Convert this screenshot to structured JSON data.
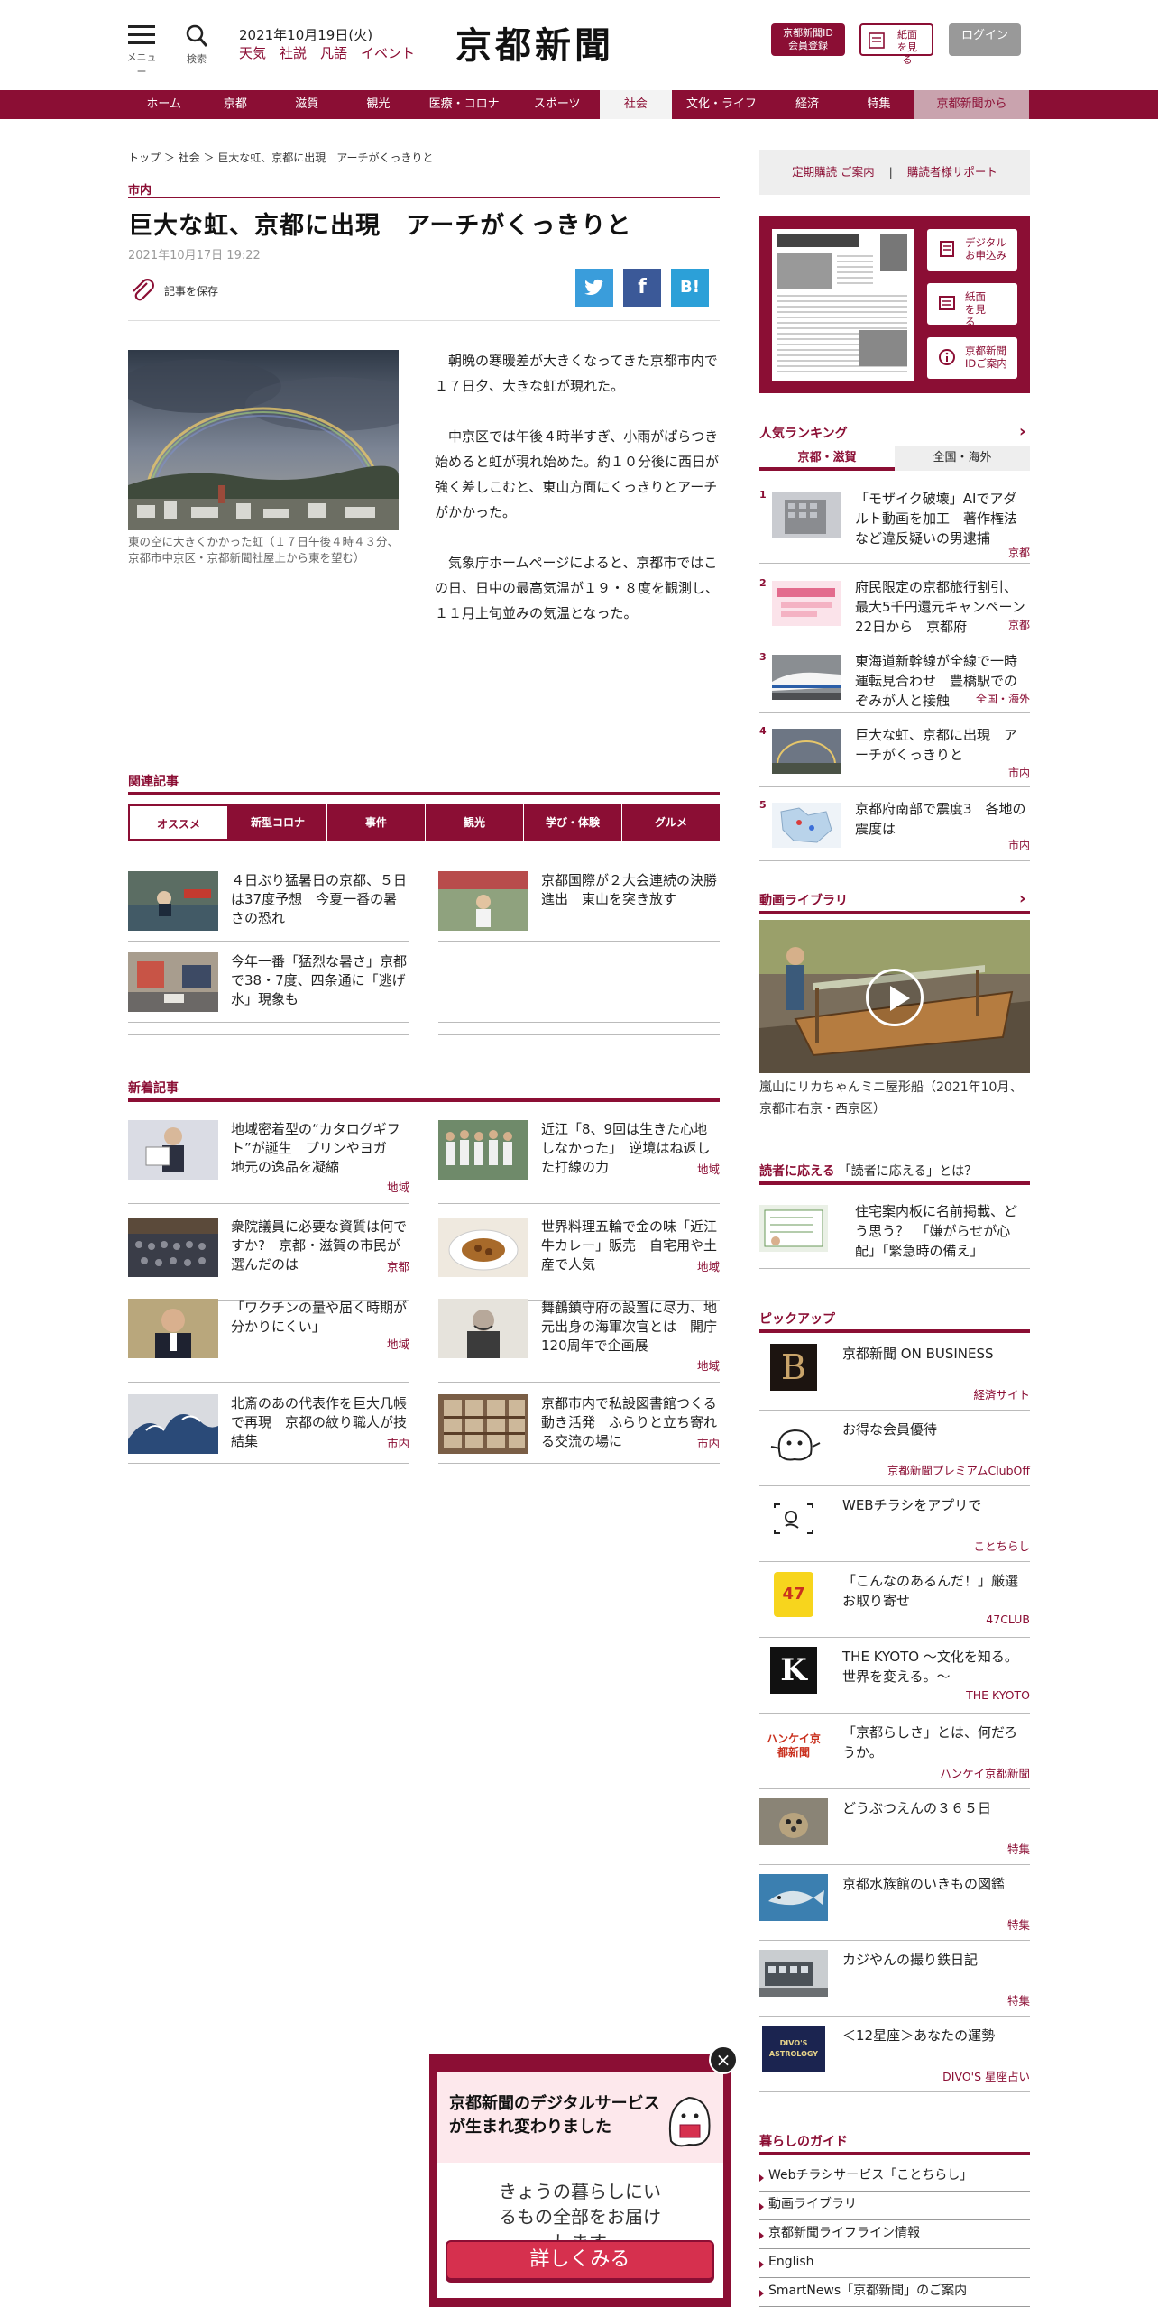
{
  "header": {
    "menu_label": "メニュー",
    "search_label": "検索",
    "date": "2021年10月19日(火)",
    "links": [
      "天気",
      "社説",
      "凡語",
      "イベント"
    ],
    "logo": "京都新聞",
    "id_button": "京都新聞ID会員登録",
    "paper_button": "紙面を見る",
    "login_button": "ログイン"
  },
  "nav": [
    "ホーム",
    "京都",
    "滋賀",
    "観光",
    "医療・コロナ",
    "スポーツ",
    "社会",
    "文化・ライフ",
    "経済",
    "特集",
    "京都新聞から"
  ],
  "breadcrumb": "トップ ＞ 社会 ＞ 巨大な虹、京都に出現　アーチがくっきりと",
  "article": {
    "section": "市内",
    "title": "巨大な虹、京都に出現　アーチがくっきりと",
    "date": "2021年10月17日 19:22",
    "save_label": "記事を保存",
    "photo_caption": "東の空に大きくかかった虹（１７日午後４時４３分、京都市中京区・京都新聞社屋上から東を望む）",
    "paragraphs": [
      "朝晩の寒暖差が大きくなってきた京都市内で１７日夕、大きな虹が現れた。",
      "中京区では午後４時半すぎ、小雨がぱらつき始めると虹が現れ始めた。約１０分後に西日が強く差しこむと、東山方面にくっきりとアーチがかかった。",
      "気象庁ホームページによると、京都市ではこの日、日中の最高気温が１９・８度を観測し、１１月上旬並みの気温となった。"
    ]
  },
  "related": {
    "heading": "関連記事",
    "tabs": [
      "オススメ",
      "新型コロナ",
      "事件",
      "観光",
      "学び・体験",
      "グルメ"
    ],
    "items": [
      {
        "title": "４日ぶり猛暑日の京都、５日は37度予想　今夏一番の暑さの恐れ"
      },
      {
        "title": "京都国際が２大会連続の決勝進出　東山を突き放す"
      },
      {
        "title": "今年一番「猛烈な暑さ」京都で38・7度、四条通に「逃げ水」現象も"
      }
    ]
  },
  "latest": {
    "heading": "新着記事",
    "items": [
      {
        "title": "地域密着型の“カタログギフト”が誕生　プリンやヨガ　地元の逸品を凝縮",
        "tag": "地域"
      },
      {
        "title": "近江「8、9回は生きた心地しなかった」　逆境はね返した打線の力",
        "tag": "地域"
      },
      {
        "title": "衆院議員に必要な資質は何ですか?　京都・滋賀の市民が選んだのは",
        "tag": "京都"
      },
      {
        "title": "世界料理五輪で金の味「近江牛カレー」販売　自宅用や土産で人気",
        "tag": "地域"
      },
      {
        "title": "「ワクチンの量や届く時期が分かりにくい」",
        "tag": "地域"
      },
      {
        "title": "舞鶴鎮守府の設置に尽力、地元出身の海軍次官とは　開庁120周年で企画展",
        "tag": "地域"
      },
      {
        "title": "北斎のあの代表作を巨大几帳で再現　京都の紋り職人が技結集",
        "tag": "市内"
      },
      {
        "title": "京都市内で私設図書館つくる動き活発　ふらりと立ち寄れる交流の場に",
        "tag": "市内"
      }
    ]
  },
  "sidebar": {
    "links": [
      "定期購読 ご案内",
      "|",
      "購読者様サポート"
    ],
    "paper_buttons": [
      "デジタルお申込み",
      "紙面を見る",
      "京都新聞IDご案内"
    ],
    "ranking": {
      "heading": "人気ランキング",
      "arrow": "›",
      "tabs": [
        "京都・滋賀",
        "全国・海外"
      ],
      "items": [
        {
          "num": "1",
          "title": "「モザイク破壊」AIでアダルト動画を加工　著作権法など違反疑いの男逮捕",
          "tag": "京都"
        },
        {
          "num": "2",
          "title": "府民限定の京都旅行割引、最大5千円還元キャンペーン　22日から　京都府",
          "tag": "京都"
        },
        {
          "num": "3",
          "title": "東海道新幹線が全線で一時運転見合わせ　豊橋駅でのぞみが人と接触",
          "tag": "全国・海外"
        },
        {
          "num": "4",
          "title": "巨大な虹、京都に出現　アーチがくっきりと",
          "tag": "市内"
        },
        {
          "num": "5",
          "title": "京都府南部で震度3　各地の震度は",
          "tag": "市内"
        }
      ]
    },
    "video": {
      "heading": "動画ライブラリ",
      "arrow": "›",
      "caption": "嵐山にリカちゃんミニ屋形船（2021年10月、京都市右京・西京区）"
    },
    "reader": {
      "heading_accent": "読者に応える",
      "heading_rest": "「読者に応える」とは？",
      "title": "住宅案内板に名前掲載、どう思う？　「嫌がらせが心配」「緊急時の備え」"
    },
    "pickup": {
      "heading": "ピックアップ",
      "items": [
        {
          "title": "京都新聞 ON BUSINESS",
          "tag": "経済サイト",
          "icon": "B"
        },
        {
          "title": "お得な会員優待",
          "tag": "京都新聞プレミアムClubOff"
        },
        {
          "title": "WEBチラシをアプリで",
          "tag": "ことちらし"
        },
        {
          "title": "「こんなのあるんだ！」厳選お取り寄せ",
          "tag": "47CLUB",
          "icon": "47"
        },
        {
          "title": "THE KYOTO ～文化を知る。世界を変える。～",
          "tag": "THE KYOTO",
          "icon": "K"
        },
        {
          "title": "「京都らしさ」とは、何だろうか。",
          "tag": "ハンケイ京都新聞",
          "icon": "ハンケイ京都新聞"
        },
        {
          "title": "どうぶつえんの３６５日",
          "tag": "特集"
        },
        {
          "title": "京都水族館のいきもの図鑑",
          "tag": "特集"
        },
        {
          "title": "カジやんの撮り鉄日記",
          "tag": "特集"
        },
        {
          "title": "＜12星座＞あなたの運勢",
          "tag": "DIVO'S 星座占い",
          "icon": "DIVO'S ASTROLOGY"
        }
      ]
    },
    "guide": {
      "heading": "暮らしのガイド",
      "items": [
        "Webチラシサービス「ことちらし」",
        "動画ライブラリ",
        "京都新聞ライフライン情報",
        "English",
        "SmartNews「京都新聞」のご案内"
      ]
    }
  },
  "popup": {
    "heading": "京都新聞のデジタルサービスが生まれ変わりました",
    "sub": "きょうの暮らしにいるもの全部をお届けします",
    "button": "詳しくみる",
    "close": "×"
  },
  "colors": {
    "brand": "#8b0e34",
    "twitter": "#3a9ddb",
    "facebook": "#3b5998",
    "hatena": "#2ca0d8"
  }
}
